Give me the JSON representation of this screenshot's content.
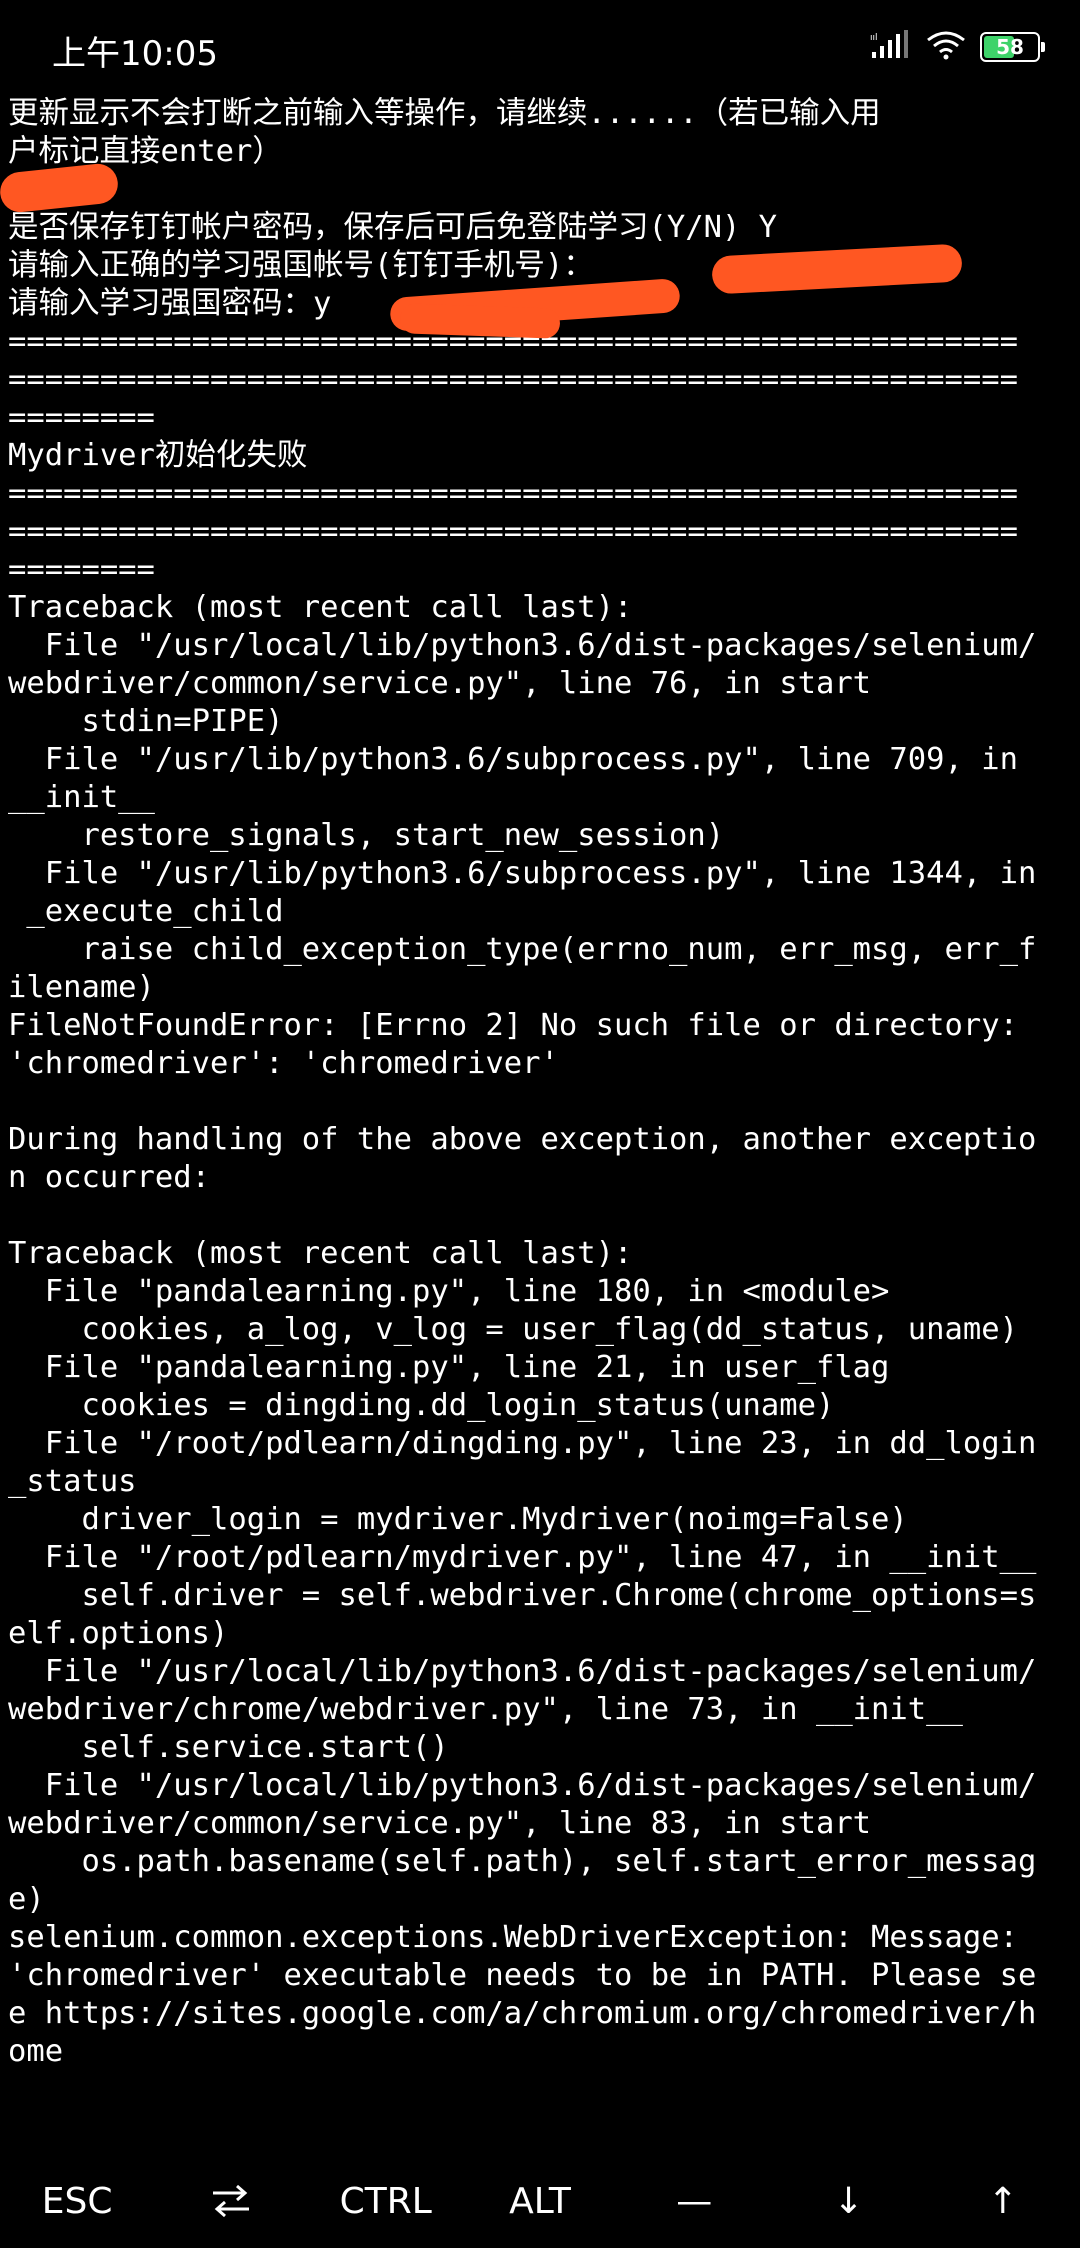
{
  "status_bar": {
    "time": "上午10:05",
    "battery_level": "58",
    "battery_fraction": 0.58,
    "battery_color": "#3ed36a",
    "icons": [
      "signal-icon",
      "wifi-icon",
      "battery-icon"
    ]
  },
  "terminal": {
    "lines": [
      "更新显示不会打断之前输入等操作，请继续......（若已输入用",
      "户标记直接enter）",
      "",
      "是否保存钉钉帐户密码，保存后可后免登陆学习(Y/N) Y",
      "请输入正确的学习强国帐号(钉钉手机号)：",
      "请输入学习强国密码：y",
      "=======================================================",
      "=======================================================",
      "========",
      "Mydriver初始化失败",
      "=======================================================",
      "=======================================================",
      "========",
      "Traceback (most recent call last):",
      "  File \"/usr/local/lib/python3.6/dist-packages/selenium/",
      "webdriver/common/service.py\", line 76, in start",
      "    stdin=PIPE)",
      "  File \"/usr/lib/python3.6/subprocess.py\", line 709, in",
      "__init__",
      "    restore_signals, start_new_session)",
      "  File \"/usr/lib/python3.6/subprocess.py\", line 1344, in",
      " _execute_child",
      "    raise child_exception_type(errno_num, err_msg, err_f",
      "ilename)",
      "FileNotFoundError: [Errno 2] No such file or directory:",
      "'chromedriver': 'chromedriver'",
      "",
      "During handling of the above exception, another exceptio",
      "n occurred:",
      "",
      "Traceback (most recent call last):",
      "  File \"pandalearning.py\", line 180, in <module>",
      "    cookies, a_log, v_log = user_flag(dd_status, uname)",
      "  File \"pandalearning.py\", line 21, in user_flag",
      "    cookies = dingding.dd_login_status(uname)",
      "  File \"/root/pdlearn/dingding.py\", line 23, in dd_login",
      "_status",
      "    driver_login = mydriver.Mydriver(noimg=False)",
      "  File \"/root/pdlearn/mydriver.py\", line 47, in __init__",
      "    self.driver = self.webdriver.Chrome(chrome_options=s",
      "elf.options)",
      "  File \"/usr/local/lib/python3.6/dist-packages/selenium/",
      "webdriver/chrome/webdriver.py\", line 73, in __init__",
      "    self.service.start()",
      "  File \"/usr/local/lib/python3.6/dist-packages/selenium/",
      "webdriver/common/service.py\", line 83, in start",
      "    os.path.basename(self.path), self.start_error_messag",
      "e)",
      "selenium.common.exceptions.WebDriverException: Message:",
      "'chromedriver' executable needs to be in PATH. Please se",
      "e https://sites.google.com/a/chromium.org/chromedriver/h",
      "ome"
    ]
  },
  "redaction_color": "#ff5722",
  "extra_keys": [
    {
      "label": "ESC",
      "icon": ""
    },
    {
      "label": "",
      "icon": "tab-swap-icon"
    },
    {
      "label": "CTRL",
      "icon": ""
    },
    {
      "label": "ALT",
      "icon": ""
    },
    {
      "label": "—",
      "icon": ""
    },
    {
      "label": "↓",
      "icon": ""
    },
    {
      "label": "↑",
      "icon": ""
    }
  ]
}
